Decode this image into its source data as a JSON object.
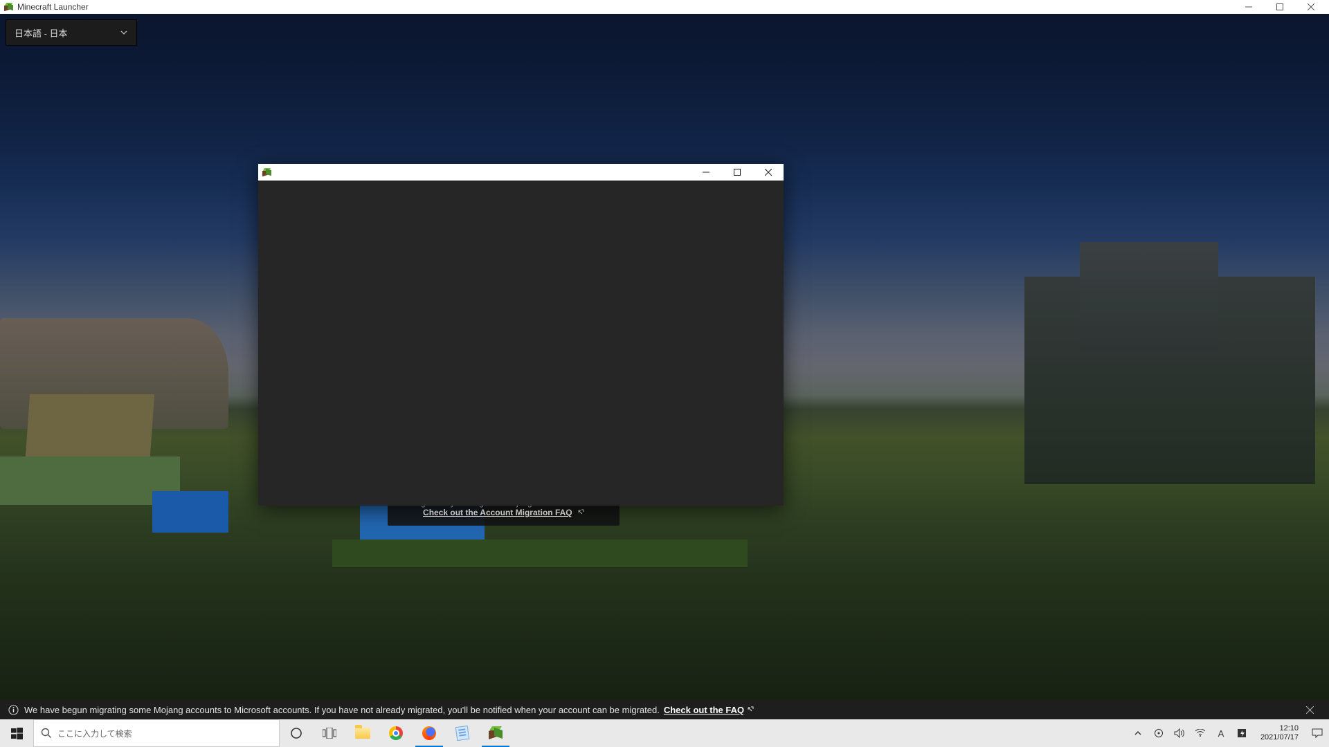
{
  "outer_window": {
    "title": "Minecraft Launcher"
  },
  "language_selector": {
    "current": "日本語 - 日本"
  },
  "migration_tooltip": {
    "line1": "We're gradually moving from Mojang accounts to Microsoft accounts.",
    "link": "Check out the Account Migration FAQ"
  },
  "bottom_banner": {
    "text": "We have begun migrating some Mojang accounts to Microsoft accounts. If you have not already migrated, you'll be notified when your account can be migrated.",
    "link": "Check out the FAQ"
  },
  "inner_window": {
    "title": ""
  },
  "taskbar": {
    "search_placeholder": "ここに入力して検索",
    "ime": "A",
    "time": "12:10",
    "date": "2021/07/17"
  },
  "icons": {
    "grass_block": "grass-block-icon",
    "chevron_down": "chevron-down-icon",
    "external": "external-link-icon",
    "info": "info-icon",
    "close": "close-icon",
    "minimize": "minimize-icon",
    "maximize": "maximize-icon",
    "windows": "windows-logo-icon",
    "search": "search-icon",
    "cortana": "cortana-circle-icon",
    "taskview": "task-view-icon",
    "explorer": "file-explorer-icon",
    "chrome": "chrome-icon",
    "firefox": "firefox-icon",
    "notepad": "notepad-icon",
    "tray_chevron": "tray-chevron-up-icon",
    "location": "location-icon",
    "volume": "volume-icon",
    "wifi": "wifi-icon",
    "power": "power-mode-icon",
    "action_center": "action-center-icon"
  }
}
